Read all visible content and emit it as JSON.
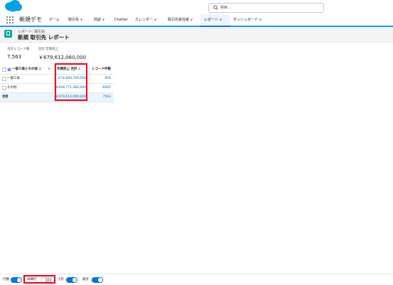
{
  "search": {
    "placeholder": "検索..."
  },
  "nav": {
    "app_name": "新規デモ",
    "items": [
      "ホーム",
      "取引先 ∨",
      "商談 ∨",
      "Chatter",
      "カレンダー ∨",
      "取引先責任者 ∨",
      "レポート ∨",
      "ダッシュボード ∨"
    ]
  },
  "header": {
    "breadcrumb": "レポート: 取引先",
    "title": "新規 取引先 レポート"
  },
  "summary": {
    "record_count_label": "合計レコード数",
    "record_count_value": "7,563",
    "revenue_label": "合計 年間売上",
    "revenue_value": "￥679,612,060,000"
  },
  "table": {
    "headers": [
      "一部三表とその他 ↓",
      "年間売上 合計 ↓",
      "レコード件数"
    ],
    "rows": [
      {
        "group": "一部三表",
        "revenue": "￥52,840,700,000",
        "count": "958"
      },
      {
        "group": "その他",
        "revenue": "￥626,771,360,000",
        "count": "6605"
      }
    ],
    "total": {
      "label": "合計",
      "revenue": "￥679,612,060,000",
      "count": "7563"
    }
  },
  "footer": {
    "row_count_label": "行数",
    "detail_rows_label": "詳細行",
    "subtotal_label": "小計",
    "grand_total_label": "総計"
  },
  "colors": {
    "accent": "#0176d3",
    "highlight": "#ea001e",
    "report_icon": "#06a59a"
  }
}
